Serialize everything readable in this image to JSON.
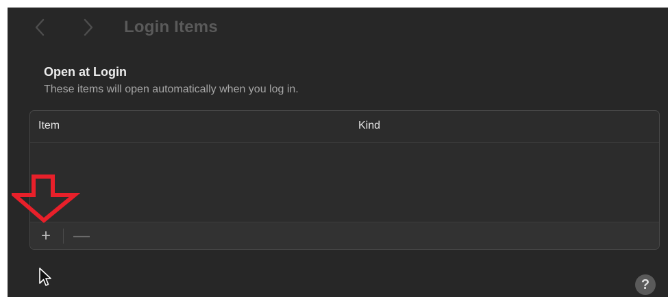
{
  "toolbar": {
    "back_icon": "chevron-left-icon",
    "forward_icon": "chevron-right-icon",
    "title": "Login Items"
  },
  "section": {
    "title": "Open at Login",
    "subtitle": "These items will open automatically when you log in."
  },
  "table": {
    "columns": [
      "Item",
      "Kind"
    ],
    "rows": []
  },
  "footer": {
    "add_label": "+",
    "remove_label": "—"
  },
  "help": {
    "label": "?"
  },
  "colors": {
    "window_background": "#272727",
    "annotation_arrow": "#e8202a",
    "title_inactive": "#5a5a5a"
  }
}
